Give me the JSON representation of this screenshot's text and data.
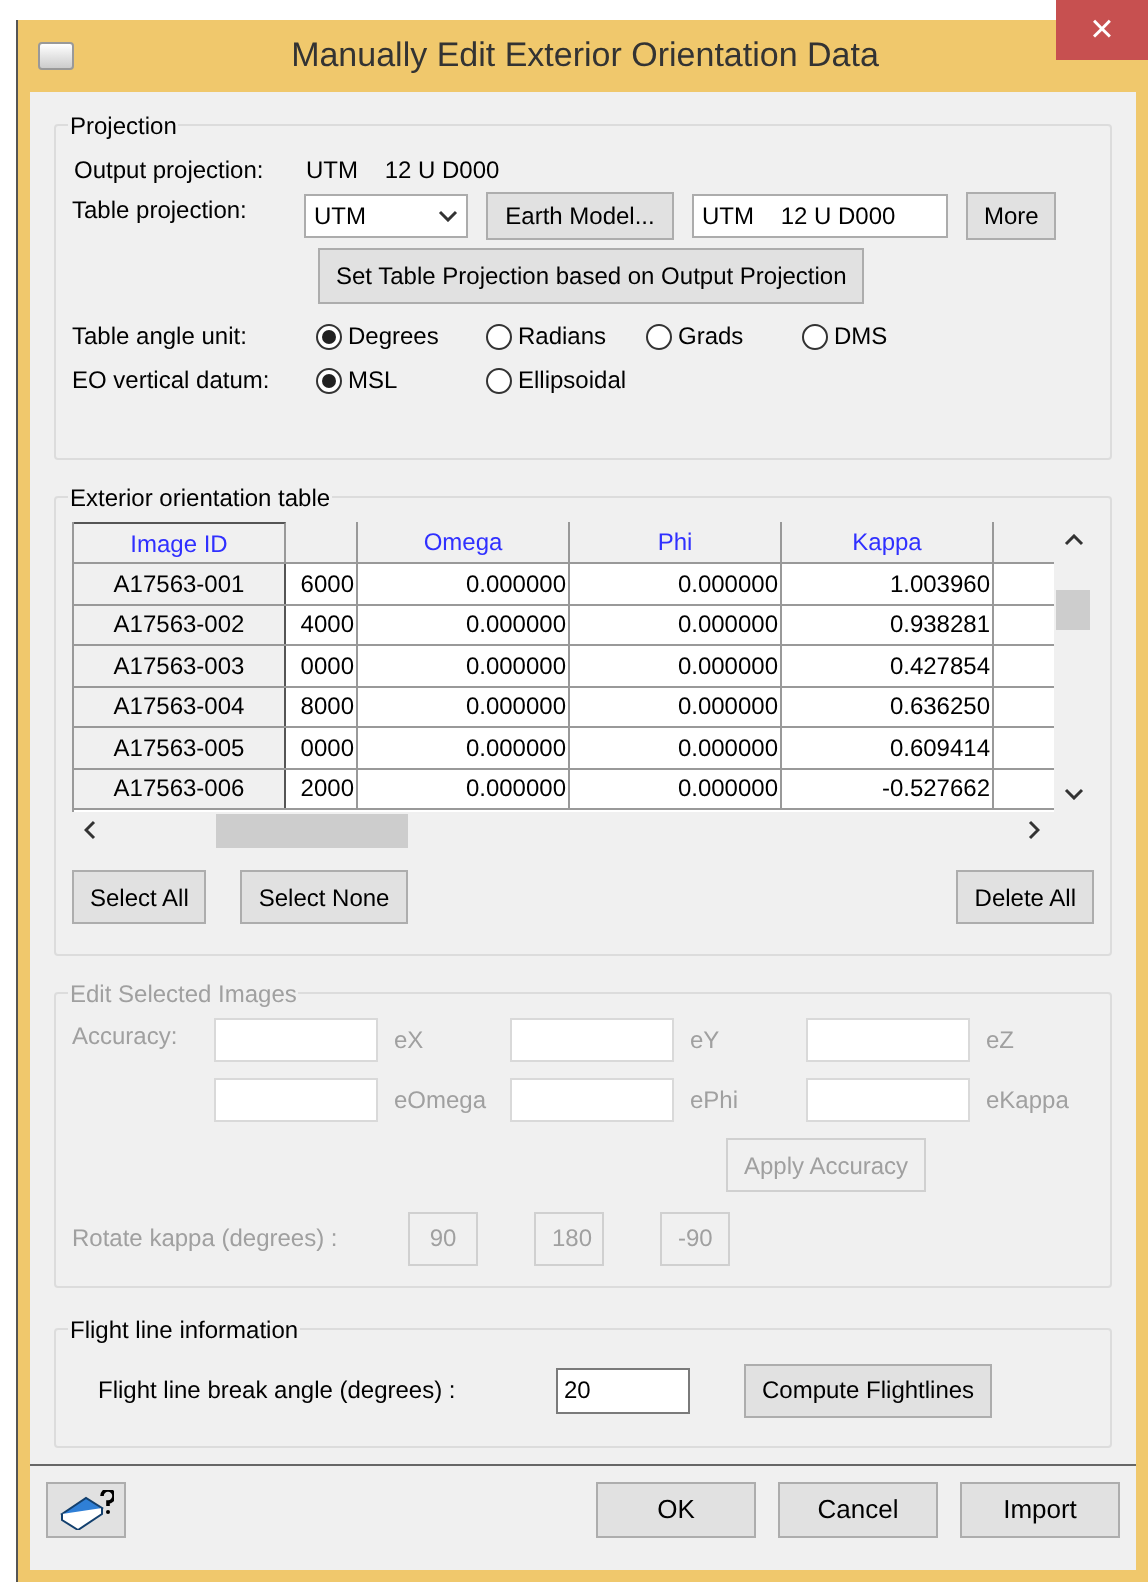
{
  "window": {
    "title": "Manually Edit Exterior Orientation Data",
    "close": "×"
  },
  "projection": {
    "title": "Projection",
    "output_label": "Output projection:",
    "output_value": "UTM    12 U D000",
    "table_label": "Table projection:",
    "table_value": "UTM",
    "earth_model_button": "Earth Model...",
    "table_projection_field": "UTM    12 U D000",
    "more_button": "More",
    "set_button": "Set Table Projection based on Output Projection",
    "angle_label": "Table angle unit:",
    "angle_units": [
      {
        "label": "Degrees",
        "selected": true
      },
      {
        "label": "Radians",
        "selected": false
      },
      {
        "label": "Grads",
        "selected": false
      },
      {
        "label": "DMS",
        "selected": false
      }
    ],
    "datum_label": "EO vertical datum:",
    "datums": [
      {
        "label": "MSL",
        "selected": true
      },
      {
        "label": "Ellipsoidal",
        "selected": false
      }
    ]
  },
  "table_group": {
    "title": "Exterior orientation table",
    "columns": [
      "Image ID",
      "",
      "Omega",
      "Phi",
      "Kappa"
    ],
    "rows": [
      [
        "A17563-001",
        "6000",
        "0.000000",
        "0.000000",
        "1.003960"
      ],
      [
        "A17563-002",
        "4000",
        "0.000000",
        "0.000000",
        "0.938281"
      ],
      [
        "A17563-003",
        "0000",
        "0.000000",
        "0.000000",
        "0.427854"
      ],
      [
        "A17563-004",
        "8000",
        "0.000000",
        "0.000000",
        "0.636250"
      ],
      [
        "A17563-005",
        "0000",
        "0.000000",
        "0.000000",
        "0.609414"
      ],
      [
        "A17563-006",
        "2000",
        "0.000000",
        "0.000000",
        "-0.527662"
      ]
    ],
    "buttons": [
      "Select All",
      "Select None",
      "Delete All"
    ]
  },
  "edit_selected": {
    "title": "Edit Selected Images",
    "disabled": true,
    "accuracy_label": "Accuracy:",
    "fields": [
      [
        "eX",
        "eY",
        "eZ"
      ],
      [
        "eOmega",
        "ePhi",
        "eKappa"
      ]
    ],
    "apply_button": "Apply Accuracy",
    "rotate_label": "Rotate kappa (degrees) :",
    "rotate_buttons": [
      "90",
      "180",
      "-90"
    ]
  },
  "flight_line": {
    "title": "Flight line information",
    "label": "Flight line break angle (degrees) :",
    "value": "20",
    "compute_button": "Compute Flightlines"
  },
  "buttons": [
    "OK",
    "Cancel",
    "Import"
  ]
}
